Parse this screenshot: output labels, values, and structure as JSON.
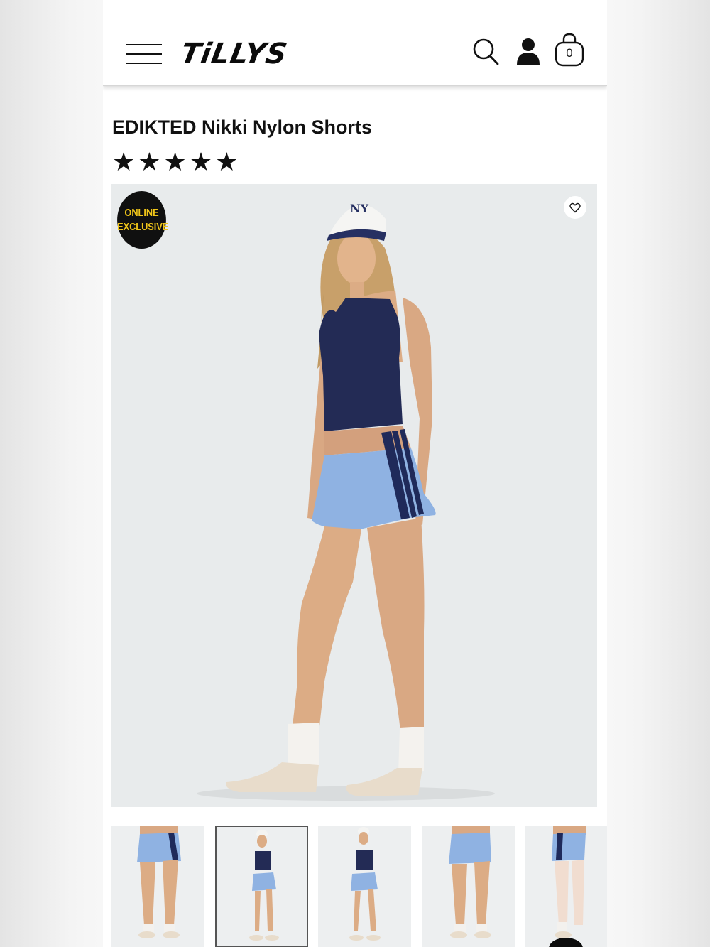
{
  "header": {
    "logo_text": "TiLLYS",
    "menu_icon": "hamburger-menu-icon",
    "search_icon": "search-icon",
    "account_icon": "user-account-icon",
    "bag_icon": "shopping-bag-icon",
    "bag_count": "0"
  },
  "product": {
    "title": "EDIKTED Nikki Nylon Shorts",
    "rating_stars": "★★★★★",
    "rating": 5,
    "badge_line1": "ONLINE",
    "badge_line2": "EXCLUSIVE",
    "wishlist_icon": "heart-icon"
  },
  "colors": {
    "accent_badge_text": "#f0c519",
    "badge_bg": "#101010",
    "shorts_blue": "#8fb2e2",
    "top_navy": "#232b55"
  },
  "thumbnails": {
    "count": 5,
    "selected_index": 1
  }
}
